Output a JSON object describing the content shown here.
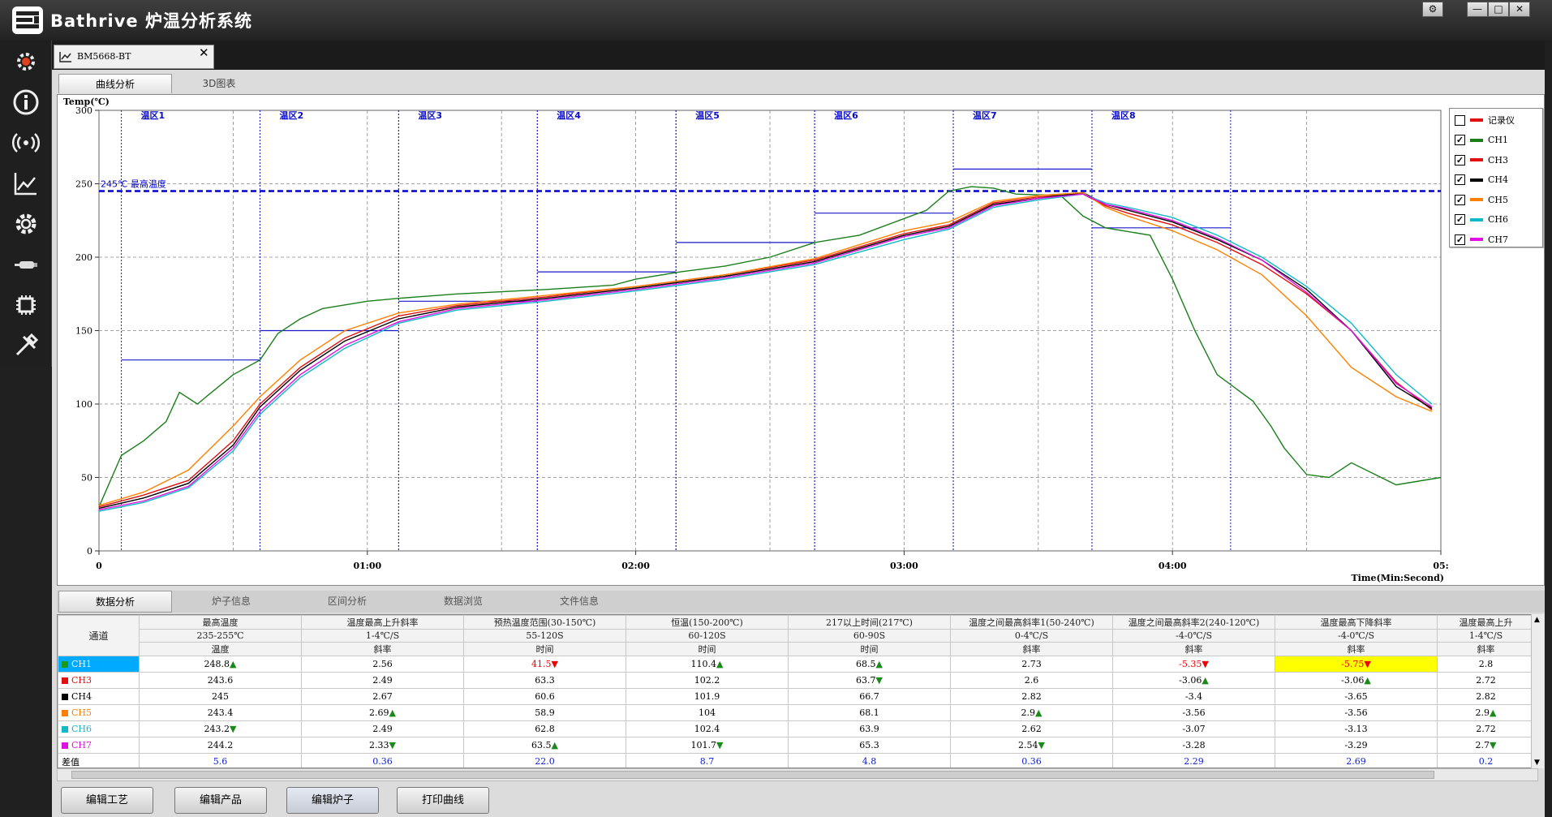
{
  "app": {
    "title": "Bathrive 炉温分析系统"
  },
  "window_buttons": [
    {
      "name": "settings-window-button",
      "icon": "gear-icon",
      "label": "⚙"
    },
    {
      "name": "minimize-button",
      "icon": "minimize-icon",
      "label": "—"
    },
    {
      "name": "maximize-button",
      "icon": "maximize-icon",
      "label": "□"
    },
    {
      "name": "close-window-button",
      "icon": "close-icon",
      "label": "✕"
    }
  ],
  "sidebar": {
    "icons": [
      "furnace-icon",
      "info-icon",
      "wireless-icon",
      "chart-icon",
      "settings-icon",
      "probe-icon",
      "chip-icon",
      "tools-icon"
    ]
  },
  "doc_tab": {
    "label": "BM5668-BT",
    "close": "✕"
  },
  "view_tabs": [
    "曲线分析",
    "3D图表"
  ],
  "chart_data": {
    "type": "line",
    "ylabel": "Temp(℃)",
    "xlabel": "Time(Min:Second)",
    "ylim": [
      0,
      300
    ],
    "xlim": [
      0,
      300
    ],
    "y_ticks": [
      "0",
      "50",
      "100",
      "150",
      "200",
      "250",
      "300"
    ],
    "x_ticks": [
      "0",
      "01:00",
      "02:00",
      "03:00",
      "04:00",
      "05:"
    ],
    "reference_line": {
      "y": 245,
      "label": "245℃ 最高温度",
      "color": "#0000cc"
    },
    "zones": [
      {
        "label": "温区1",
        "start": 5,
        "end": 36,
        "setpoint": 130
      },
      {
        "label": "温区2",
        "start": 36,
        "end": 67,
        "setpoint": 150
      },
      {
        "label": "温区3",
        "start": 67,
        "end": 98,
        "setpoint": 170
      },
      {
        "label": "温区4",
        "start": 98,
        "end": 129,
        "setpoint": 190
      },
      {
        "label": "温区5",
        "start": 129,
        "end": 160,
        "setpoint": 210
      },
      {
        "label": "温区6",
        "start": 160,
        "end": 191,
        "setpoint": 230
      },
      {
        "label": "温区7",
        "start": 191,
        "end": 222,
        "setpoint": 260
      },
      {
        "label": "温区8",
        "start": 222,
        "end": 253,
        "setpoint": 220
      }
    ],
    "series": [
      {
        "name": "CH1",
        "color": "#1a7f1a",
        "x": [
          0,
          5,
          10,
          15,
          18,
          22,
          30,
          36,
          40,
          45,
          50,
          60,
          67,
          80,
          100,
          115,
          120,
          130,
          140,
          150,
          160,
          170,
          185,
          190,
          195,
          200,
          205,
          215,
          220,
          225,
          235,
          240,
          245,
          250,
          258,
          262,
          265,
          270,
          275,
          280,
          290,
          300
        ],
        "y": [
          30,
          65,
          75,
          88,
          108,
          100,
          120,
          130,
          148,
          158,
          165,
          170,
          172,
          175,
          178,
          181,
          185,
          190,
          194,
          200,
          210,
          215,
          232,
          245,
          248,
          247,
          243,
          242,
          228,
          220,
          215,
          185,
          150,
          120,
          102,
          85,
          70,
          52,
          50,
          60,
          45,
          50
        ]
      },
      {
        "name": "CH3",
        "color": "#e01010",
        "x": [
          0,
          10,
          20,
          30,
          36,
          45,
          55,
          67,
          80,
          100,
          120,
          140,
          160,
          180,
          190,
          200,
          210,
          220,
          225,
          230,
          240,
          250,
          260,
          270,
          280,
          290,
          298
        ],
        "y": [
          30,
          38,
          48,
          75,
          100,
          125,
          145,
          160,
          167,
          173,
          180,
          188,
          198,
          216,
          222,
          237,
          241,
          243,
          235,
          230,
          222,
          210,
          195,
          175,
          150,
          115,
          96
        ]
      },
      {
        "name": "CH4",
        "color": "#000000",
        "x": [
          0,
          10,
          20,
          30,
          36,
          45,
          55,
          67,
          80,
          100,
          120,
          140,
          160,
          180,
          190,
          200,
          210,
          220,
          225,
          230,
          240,
          250,
          260,
          270,
          280,
          290,
          298
        ],
        "y": [
          29,
          36,
          46,
          72,
          98,
          123,
          143,
          158,
          166,
          172,
          179,
          187,
          197,
          215,
          221,
          236,
          240,
          244,
          236,
          232,
          224,
          212,
          198,
          178,
          150,
          112,
          97
        ]
      },
      {
        "name": "CH5",
        "color": "#ff8000",
        "x": [
          0,
          10,
          20,
          30,
          36,
          45,
          55,
          67,
          80,
          100,
          120,
          140,
          160,
          180,
          190,
          200,
          210,
          220,
          225,
          230,
          240,
          250,
          260,
          270,
          280,
          290,
          298
        ],
        "y": [
          31,
          40,
          55,
          85,
          105,
          130,
          150,
          162,
          168,
          174,
          180,
          188,
          199,
          218,
          224,
          238,
          242,
          244,
          234,
          228,
          218,
          205,
          188,
          160,
          125,
          105,
          95
        ]
      },
      {
        "name": "CH6",
        "color": "#10b8c8",
        "x": [
          0,
          10,
          20,
          30,
          36,
          45,
          55,
          67,
          80,
          100,
          120,
          140,
          160,
          180,
          190,
          200,
          210,
          220,
          225,
          230,
          240,
          250,
          260,
          270,
          280,
          290,
          298
        ],
        "y": [
          27,
          33,
          43,
          68,
          93,
          118,
          138,
          155,
          164,
          170,
          177,
          185,
          195,
          212,
          219,
          234,
          239,
          243,
          237,
          234,
          227,
          215,
          200,
          180,
          155,
          120,
          100
        ]
      },
      {
        "name": "CH7",
        "color": "#e010e0",
        "x": [
          0,
          10,
          20,
          30,
          36,
          45,
          55,
          67,
          80,
          100,
          120,
          140,
          160,
          180,
          190,
          200,
          210,
          220,
          225,
          230,
          240,
          250,
          260,
          270,
          280,
          290,
          298
        ],
        "y": [
          28,
          34,
          44,
          70,
          95,
          120,
          140,
          156,
          165,
          171,
          178,
          186,
          196,
          214,
          220,
          235,
          240,
          243,
          236,
          233,
          225,
          213,
          198,
          176,
          150,
          114,
          98
        ]
      }
    ]
  },
  "legend": [
    {
      "label": "记录仪",
      "color": "#e01010",
      "checked": ""
    },
    {
      "label": "CH1",
      "color": "#1a7f1a",
      "checked": "✓"
    },
    {
      "label": "CH3",
      "color": "#e01010",
      "checked": "✓"
    },
    {
      "label": "CH4",
      "color": "#000000",
      "checked": "✓"
    },
    {
      "label": "CH5",
      "color": "#ff8000",
      "checked": "✓"
    },
    {
      "label": "CH6",
      "color": "#10b8c8",
      "checked": "✓"
    },
    {
      "label": "CH7",
      "color": "#e010e0",
      "checked": "✓"
    }
  ],
  "bottom_tabs": [
    "数据分析",
    "炉子信息",
    "区间分析",
    "数据浏览",
    "文件信息"
  ],
  "table": {
    "corner": "通道",
    "columns": [
      {
        "title": "最高温度",
        "spec": "235-255℃",
        "unit": "温度"
      },
      {
        "title": "温度最高上升斜率",
        "spec": "1-4℃/S",
        "unit": "斜率"
      },
      {
        "title": "预热温度范围(30-150℃)",
        "spec": "55-120S",
        "unit": "时间"
      },
      {
        "title": "恒温(150-200℃)",
        "spec": "60-120S",
        "unit": "时间"
      },
      {
        "title": "217以上时间(217℃)",
        "spec": "60-90S",
        "unit": "时间"
      },
      {
        "title": "温度之间最高斜率1(50-240℃)",
        "spec": "0-4℃/S",
        "unit": "斜率"
      },
      {
        "title": "温度之间最高斜率2(240-120℃)",
        "spec": "-4-0℃/S",
        "unit": "斜率"
      },
      {
        "title": "温度最高下降斜率",
        "spec": "-4-0℃/S",
        "unit": "斜率"
      },
      {
        "title": "温度最高上升",
        "spec": "1-4℃/S",
        "unit": "斜率"
      }
    ],
    "rows": [
      {
        "label": "CH1",
        "color": "#1a9a1a",
        "selected": true,
        "cells": [
          [
            "248.8",
            "up"
          ],
          [
            "2.56",
            ""
          ],
          [
            "41.5",
            "dn"
          ],
          [
            "110.4",
            "up"
          ],
          [
            "68.5",
            "up"
          ],
          [
            "2.73",
            ""
          ],
          [
            "-5.35",
            "dn"
          ],
          [
            "-5.75",
            "dn"
          ],
          [
            "2.8",
            ""
          ]
        ]
      },
      {
        "label": "CH3",
        "color": "#e01010",
        "selected": false,
        "cells": [
          [
            "243.6",
            ""
          ],
          [
            "2.49",
            ""
          ],
          [
            "63.3",
            ""
          ],
          [
            "102.2",
            ""
          ],
          [
            "63.7",
            "dnG"
          ],
          [
            "2.6",
            ""
          ],
          [
            "-3.06",
            "up"
          ],
          [
            "-3.06",
            "up"
          ],
          [
            "2.72",
            ""
          ]
        ]
      },
      {
        "label": "CH4",
        "color": "#000000",
        "selected": false,
        "cells": [
          [
            "245",
            ""
          ],
          [
            "2.67",
            ""
          ],
          [
            "60.6",
            ""
          ],
          [
            "101.9",
            ""
          ],
          [
            "66.7",
            ""
          ],
          [
            "2.82",
            ""
          ],
          [
            "-3.4",
            ""
          ],
          [
            "-3.65",
            ""
          ],
          [
            "2.82",
            ""
          ]
        ]
      },
      {
        "label": "CH5",
        "color": "#ff8000",
        "selected": false,
        "cells": [
          [
            "243.4",
            ""
          ],
          [
            "2.69",
            "up"
          ],
          [
            "58.9",
            ""
          ],
          [
            "104",
            ""
          ],
          [
            "68.1",
            ""
          ],
          [
            "2.9",
            "up"
          ],
          [
            "-3.56",
            ""
          ],
          [
            "-3.56",
            ""
          ],
          [
            "2.9",
            "up"
          ]
        ]
      },
      {
        "label": "CH6",
        "color": "#10b8c8",
        "selected": false,
        "cells": [
          [
            "243.2",
            "dnG"
          ],
          [
            "2.49",
            ""
          ],
          [
            "62.8",
            ""
          ],
          [
            "102.4",
            ""
          ],
          [
            "63.9",
            ""
          ],
          [
            "2.62",
            ""
          ],
          [
            "-3.07",
            ""
          ],
          [
            "-3.13",
            ""
          ],
          [
            "2.72",
            ""
          ]
        ]
      },
      {
        "label": "CH7",
        "color": "#e010e0",
        "selected": false,
        "cells": [
          [
            "244.2",
            ""
          ],
          [
            "2.33",
            "dnG"
          ],
          [
            "63.5",
            "up"
          ],
          [
            "101.7",
            "dnG"
          ],
          [
            "65.3",
            ""
          ],
          [
            "2.54",
            "dnG"
          ],
          [
            "-3.28",
            ""
          ],
          [
            "-3.29",
            ""
          ],
          [
            "2.7",
            "dnG"
          ]
        ]
      }
    ],
    "diff": {
      "label": "差值",
      "cells": [
        "5.6",
        "0.36",
        "22.0",
        "8.7",
        "4.8",
        "0.36",
        "2.29",
        "2.69",
        "0.2"
      ]
    }
  },
  "actions": [
    "编辑工艺",
    "编辑产品",
    "编辑炉子",
    "打印曲线"
  ]
}
